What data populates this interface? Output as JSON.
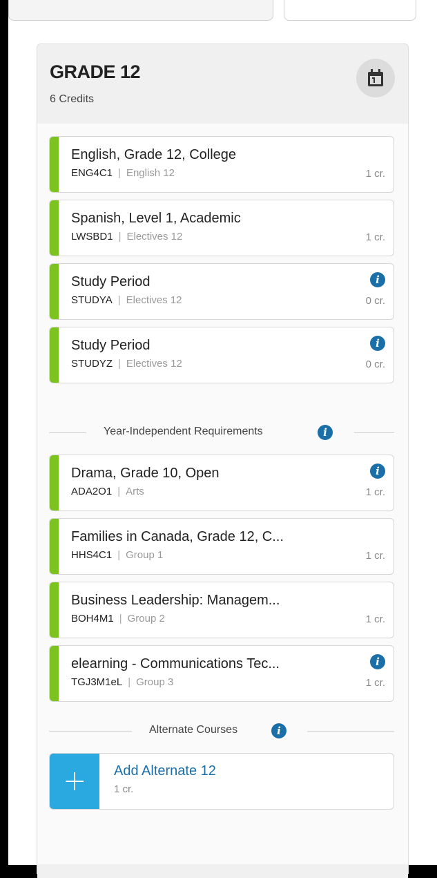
{
  "header": {
    "title": "GRADE 12",
    "credits": "6 Credits",
    "calendar_icon": "calendar-icon"
  },
  "courses": [
    {
      "name": "English, Grade 12, College",
      "code": "ENG4C1",
      "category": "English 12",
      "credits": "1 cr.",
      "info": false
    },
    {
      "name": "Spanish, Level 1, Academic",
      "code": "LWSBD1",
      "category": "Electives 12",
      "credits": "1 cr.",
      "info": false
    },
    {
      "name": "Study Period",
      "code": "STUDYA",
      "category": "Electives 12",
      "credits": "0 cr.",
      "info": true
    },
    {
      "name": "Study Period",
      "code": "STUDYZ",
      "category": "Electives 12",
      "credits": "0 cr.",
      "info": true
    }
  ],
  "year_independent": {
    "label": "Year-Independent Requirements",
    "courses": [
      {
        "name": "Drama, Grade 10, Open",
        "code": "ADA2O1",
        "category": "Arts",
        "credits": "1 cr.",
        "info": true
      },
      {
        "name": "Families in Canada, Grade 12, C...",
        "code": "HHS4C1",
        "category": "Group 1",
        "credits": "1 cr.",
        "info": false
      },
      {
        "name": "Business Leadership: Managem...",
        "code": "BOH4M1",
        "category": "Group 2",
        "credits": "1 cr.",
        "info": false
      },
      {
        "name": "elearning - Communications Tec...",
        "code": "TGJ3M1eL",
        "category": "Group 3",
        "credits": "1 cr.",
        "info": true
      }
    ]
  },
  "alternates": {
    "label": "Alternate Courses",
    "add_title": "Add Alternate 12",
    "add_credits": "1 cr."
  },
  "separator": "|",
  "info_glyph": "i",
  "colors": {
    "accent_green": "#7cc31f",
    "info_blue": "#1a6fa8",
    "add_blue": "#2aa9e0"
  }
}
